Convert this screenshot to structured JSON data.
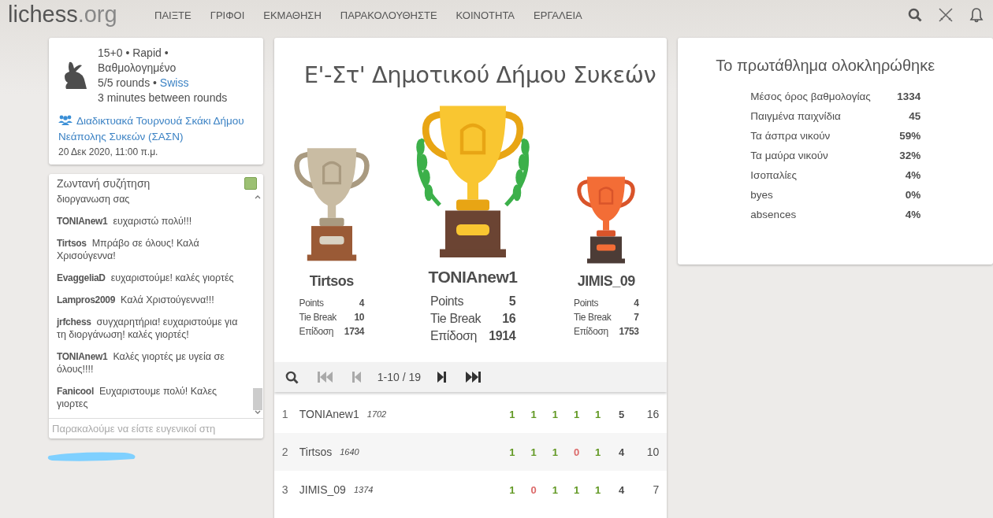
{
  "header": {
    "logo": {
      "main": "lichess",
      "suffix": ".org"
    },
    "nav": [
      "ΠΑΙΞΤΕ",
      "ΓΡΙΦΟΙ",
      "ΕΚΜΑΘΗΣΗ",
      "ΠΑΡΑΚΟΛΟΥΘΗΣΤΕ",
      "ΚΟΙΝΟΤΗΤΑ",
      "ΕΡΓΑΛΕΙΑ"
    ]
  },
  "info": {
    "line1": "15+0 • Rapid •",
    "line2": "Βαθμολογημένο",
    "rounds": "5/5 rounds •",
    "system": "Swiss",
    "between": "3 minutes between rounds",
    "team": "Διαδικτυακά Τουρνουά Σκάκι Δήμου Νεάπολης Συκεών (ΣΑΣΝ)",
    "date": "20 Δεκ 2020, 11:00 π.μ."
  },
  "chat": {
    "title": "Ζωντανή συζήτηση",
    "on": true,
    "placeholder": "Παρακαλούμε να είστε ευγενικοί στη",
    "messages": [
      {
        "kind": "continuation",
        "text": "διοργανωση σας"
      },
      {
        "kind": "message",
        "user": "TONIAnew1",
        "text": "ευχαριστώ πολύ!!!"
      },
      {
        "kind": "message",
        "user": "Tirtsos",
        "text": "Μπράβο σε όλους! Καλά Χρισούγεννα!"
      },
      {
        "kind": "message",
        "user": "EvaggeliaD",
        "text": "ευχαριστούμε! καλές γιορτές"
      },
      {
        "kind": "message",
        "user": "Lampros2009",
        "text": "Καλά Χριστούγεννα!!!"
      },
      {
        "kind": "message",
        "user": "jrfchess",
        "text": "συγχαρητήρια! ευχαριστούμε για τη διοργάνωση! καλές γιορτές!"
      },
      {
        "kind": "message",
        "user": "TONIAnew1",
        "text": "Καλές γιορτές με υγεία σε όλους!!!!"
      },
      {
        "kind": "message",
        "user": "Fanicool",
        "text": "Ευχαριστουμε πολύ! Καλες γιορτες"
      }
    ]
  },
  "tournament": {
    "title": "Ε'-Στ' Δημοτικού Δήμου Συκεών",
    "podium": [
      {
        "kind": "second",
        "name": "Tirtsos",
        "stats": [
          {
            "label": "Points",
            "value": "4"
          },
          {
            "label": "Tie Break",
            "value": "10"
          },
          {
            "label": "Επίδοση",
            "value": "1734"
          }
        ]
      },
      {
        "kind": "first",
        "name": "TONIAnew1",
        "stats": [
          {
            "label": "Points",
            "value": "5"
          },
          {
            "label": "Tie Break",
            "value": "16"
          },
          {
            "label": "Επίδοση",
            "value": "1914"
          }
        ]
      },
      {
        "kind": "third",
        "name": "JIMIS_09",
        "stats": [
          {
            "label": "Points",
            "value": "4"
          },
          {
            "label": "Tie Break",
            "value": "7"
          },
          {
            "label": "Επίδοση",
            "value": "1753"
          }
        ]
      }
    ],
    "pager": {
      "range": "1-10 / 19",
      "first_disabled": true,
      "prev_disabled": true,
      "next_disabled": false,
      "last_disabled": false
    },
    "standings": [
      {
        "rank": "1",
        "name": "TONIAnew1",
        "rating": "1702",
        "results": [
          {
            "value": "1",
            "kind": "win"
          },
          {
            "value": "1",
            "kind": "win"
          },
          {
            "value": "1",
            "kind": "win"
          },
          {
            "value": "1",
            "kind": "win"
          },
          {
            "value": "1",
            "kind": "win"
          }
        ],
        "points": "5",
        "tiebreak": "16"
      },
      {
        "rank": "2",
        "name": "Tirtsos",
        "rating": "1640",
        "results": [
          {
            "value": "1",
            "kind": "win"
          },
          {
            "value": "1",
            "kind": "win"
          },
          {
            "value": "1",
            "kind": "win"
          },
          {
            "value": "0",
            "kind": "loss"
          },
          {
            "value": "1",
            "kind": "win"
          }
        ],
        "points": "4",
        "tiebreak": "10"
      },
      {
        "rank": "3",
        "name": "JIMIS_09",
        "rating": "1374",
        "results": [
          {
            "value": "1",
            "kind": "win"
          },
          {
            "value": "0",
            "kind": "loss"
          },
          {
            "value": "1",
            "kind": "win"
          },
          {
            "value": "1",
            "kind": "win"
          },
          {
            "value": "1",
            "kind": "win"
          }
        ],
        "points": "4",
        "tiebreak": "7"
      }
    ]
  },
  "summary": {
    "title": "Το πρωτάθλημα ολοκληρώθηκε",
    "stats": [
      {
        "label": "Μέσος όρος βαθμολογίας",
        "value": "1334"
      },
      {
        "label": "Παιγμένα παιχνίδια",
        "value": "45"
      },
      {
        "label": "Τα άσπρα νικούν",
        "value": "59%"
      },
      {
        "label": "Τα μαύρα νικούν",
        "value": "32%"
      },
      {
        "label": "Ισοπαλίες",
        "value": "4%"
      },
      {
        "label": "byes",
        "value": "0%"
      },
      {
        "label": "absences",
        "value": "4%"
      }
    ]
  }
}
